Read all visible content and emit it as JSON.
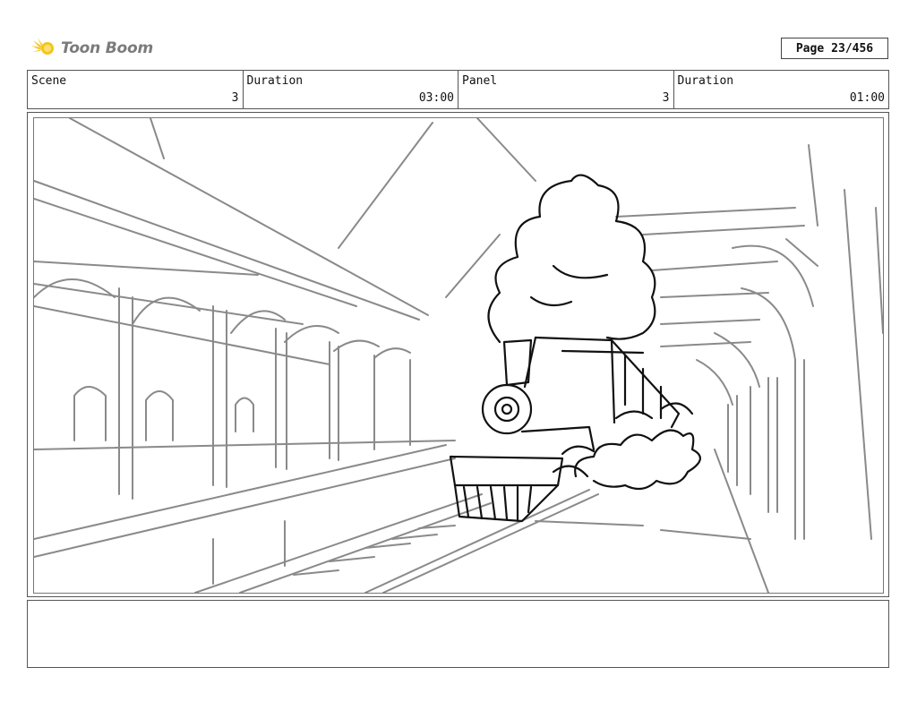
{
  "brand": {
    "name": "Toon Boom",
    "accent": "#f5c518"
  },
  "page": {
    "label": "Page",
    "number": "23/456"
  },
  "info": {
    "scene": {
      "label": "Scene",
      "value": "3"
    },
    "scene_duration": {
      "label": "Duration",
      "value": "03:00"
    },
    "panel": {
      "label": "Panel",
      "value": "3"
    },
    "panel_duration": {
      "label": "Duration",
      "value": "01:00"
    }
  },
  "panel_image": {
    "icon": "storyboard-sketch-train-station"
  },
  "notes": {
    "text": ""
  }
}
